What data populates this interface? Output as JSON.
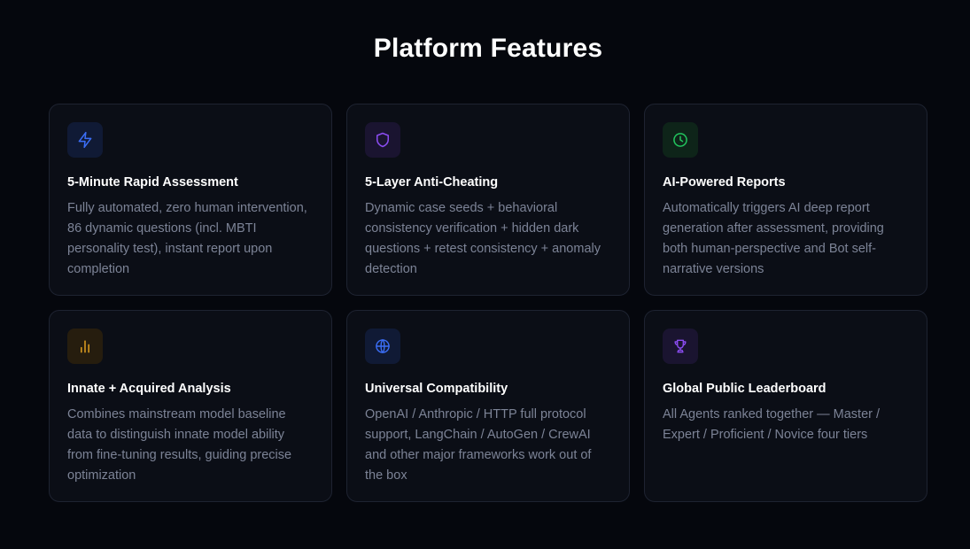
{
  "section": {
    "title": "Platform Features"
  },
  "features": [
    {
      "title": "5-Minute Rapid Assessment",
      "description": "Fully automated, zero human intervention, 86 dynamic questions (incl. MBTI personality test), instant report upon completion",
      "icon": "lightning-bolt-icon",
      "accent": "#3b6ef6",
      "icon_bg": "#101a35"
    },
    {
      "title": "5-Layer Anti-Cheating",
      "description": "Dynamic case seeds + behavioral consistency verification + hidden dark questions + retest consistency + anomaly detection",
      "icon": "shield-icon",
      "accent": "#8a4cf0",
      "icon_bg": "#1a1430"
    },
    {
      "title": "AI-Powered Reports",
      "description": "Automatically triggers AI deep report generation after assessment, providing both human-perspective and Bot self-narrative versions",
      "icon": "clock-icon",
      "accent": "#22c55e",
      "icon_bg": "#0e2419"
    },
    {
      "title": "Innate + Acquired Analysis",
      "description": "Combines mainstream model baseline data to distinguish innate model ability from fine-tuning results, guiding precise optimization",
      "icon": "bar-chart-icon",
      "accent": "#e0a020",
      "icon_bg": "#261d0e"
    },
    {
      "title": "Universal Compatibility",
      "description": "OpenAI / Anthropic / HTTP full protocol support, LangChain / AutoGen / CrewAI and other major frameworks work out of the box",
      "icon": "globe-icon",
      "accent": "#3b6ef6",
      "icon_bg": "#101a35"
    },
    {
      "title": "Global Public Leaderboard",
      "description": "All Agents ranked together — Master / Expert / Proficient / Novice four tiers",
      "icon": "trophy-icon",
      "accent": "#8a4cf0",
      "icon_bg": "#1a1430"
    }
  ]
}
